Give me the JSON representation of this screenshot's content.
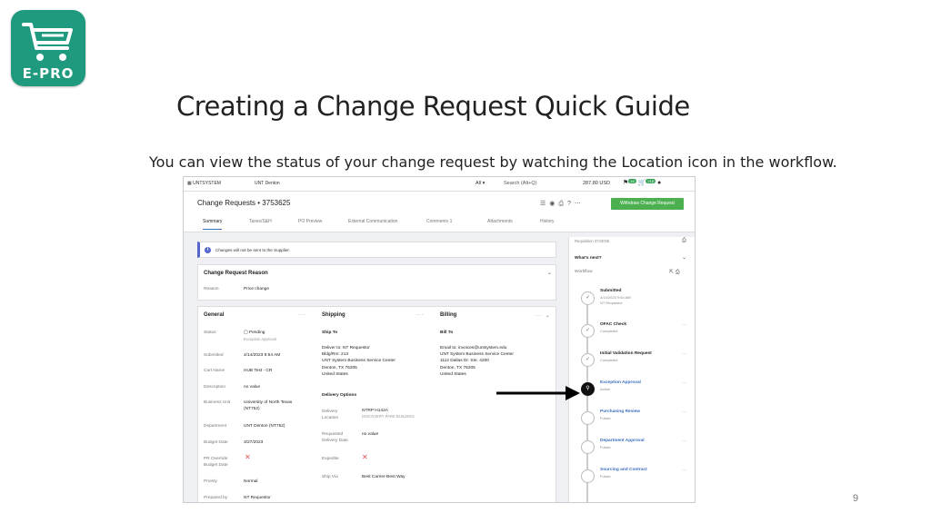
{
  "slide": {
    "logo_text": "E-PRO",
    "title": "Creating a Change Request Quick Guide",
    "subtitle": "You can view the status of your change request by watching the Location icon in the workflow.",
    "page_number": "9"
  },
  "colors": {
    "logo_bg": "#1f9a7e",
    "action_green": "#4caf50",
    "link_blue": "#3b6dbf",
    "alert_purple": "#5566cc",
    "error_red": "#e05050"
  },
  "topbar": {
    "brand": "UNTSYSTEM",
    "brand2": "UNT Denton",
    "all_label": "All ▾",
    "search_placeholder": "Search (Alt+Q)",
    "amount": "287.80 USD",
    "badge1": "16",
    "badge2": "218"
  },
  "header": {
    "title": "Change Requests  •  3753625",
    "withdraw_button": "Withdraw Change Request",
    "tabs": [
      "Summary",
      "Taxes/S&H",
      "PO Preview",
      "External Communication",
      "Comments",
      "Attachments",
      "History"
    ],
    "comments_count": "1"
  },
  "alert": {
    "text": "Changes will not be sent to the Supplier."
  },
  "reason": {
    "title": "Change Request Reason",
    "label": "Reason",
    "value": "Price change"
  },
  "general": {
    "title": "General",
    "fields": [
      {
        "label": "Status",
        "value": "Pending",
        "sub": "Exception Approval"
      },
      {
        "label": "Submitted",
        "value": "4/14/2023 9:54 AM"
      },
      {
        "label": "Cart Name",
        "value": "HUB Test - CR"
      },
      {
        "label": "Description",
        "value": "no value"
      },
      {
        "label": "Business Unit",
        "value": "University of North Texas (NT752)"
      },
      {
        "label": "Department",
        "value": "UNT Denton (NT752)"
      },
      {
        "label": "Budget Date",
        "value": "3/27/2023"
      },
      {
        "label": "PR Override Budget Date",
        "value": ""
      },
      {
        "label": "Priority",
        "value": "Normal"
      },
      {
        "label": "Prepared by",
        "value": "NT Requestor"
      }
    ]
  },
  "shipping": {
    "title": "Shipping",
    "ship_to_title": "Ship To",
    "address": [
      "Deliver to: NT Requestor",
      "Bldg/Rm: 213",
      "UNT System Business Service Center",
      "Denton, TX 76205",
      "United States"
    ],
    "delivery_title": "Delivery Options",
    "delivery_label": "Delivery Location",
    "delivery_value": "NTRP H142A",
    "delivery_sub": "DISCOVERY PARK BUILDING",
    "requested_label": "Requested Delivery Date",
    "requested_value": "no value",
    "expedite_label": "Expedite",
    "shipvia_label": "Ship Via",
    "shipvia_value": "Best Carrier-Best Way"
  },
  "billing": {
    "title": "Billing",
    "bill_to_title": "Bill To",
    "address": [
      "Email to: invoices@untsystem.edu",
      "UNT System Business Service Center",
      "1112 Dallas Dr. Ste. 4200",
      "Denton, TX 76205",
      "United States"
    ]
  },
  "workflow": {
    "requisition": "Requisition 3743035",
    "whats_next": "What's next?",
    "label": "Workflow",
    "steps": [
      {
        "name": "Submitted",
        "status": "4/14/2023 9:54 AM",
        "extra": "NT Requestor",
        "icon": "check-icon"
      },
      {
        "name": "OFAC Check",
        "status": "Completed",
        "icon": "check-icon"
      },
      {
        "name": "Initial Validation Request",
        "status": "Completed",
        "icon": "check-icon"
      },
      {
        "name": "Exception Approval",
        "status": "Active",
        "icon": "location-pin-icon"
      },
      {
        "name": "Purchasing Review",
        "status": "Future",
        "icon": "circle-icon"
      },
      {
        "name": "Department Approval",
        "status": "Future",
        "icon": "circle-icon"
      },
      {
        "name": "Sourcing and Contract",
        "status": "Future",
        "icon": "circle-icon"
      }
    ]
  }
}
